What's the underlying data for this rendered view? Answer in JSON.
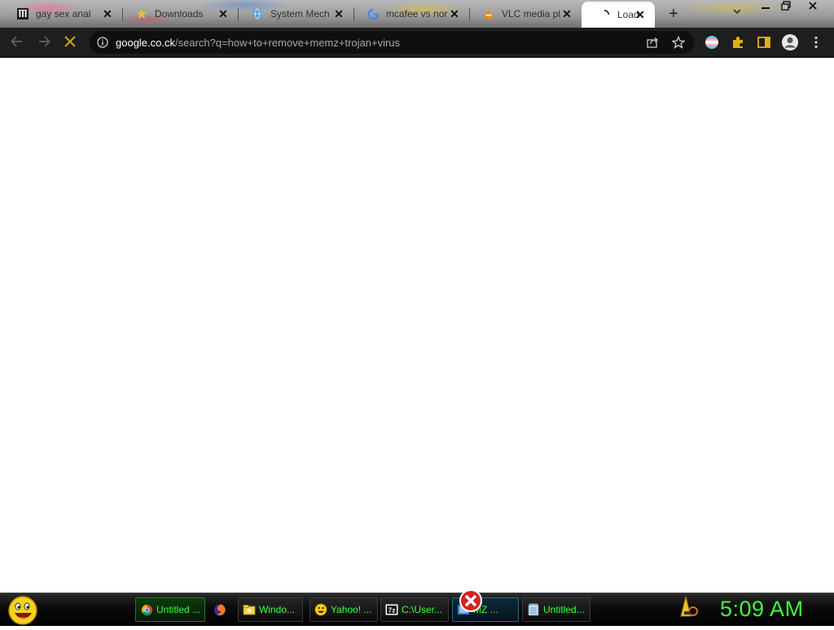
{
  "browser": {
    "tabs": [
      {
        "title": "gay sex anal",
        "icon": "library-icon"
      },
      {
        "title": "Downloads",
        "icon": "star-icon"
      },
      {
        "title": "System Mech",
        "icon": "globe-icon"
      },
      {
        "title": "mcafee vs nor",
        "icon": "google-icon"
      },
      {
        "title": "VLC media pl",
        "icon": "vlc-icon"
      },
      {
        "title": "Load",
        "icon": "loading-icon",
        "active": true
      }
    ],
    "new_tab": "+",
    "address": {
      "host": "google.co.ck",
      "path": "/search?q=how+to+remove+memz+trojan+virus"
    },
    "colors": {
      "toolbar": "#1e1e1e",
      "omnibox": "#0f0f0f",
      "accent_extensions": "#e0b010"
    }
  },
  "taskbar": {
    "buttons": [
      {
        "label": "Untitled ...",
        "icon": "chrome-icon"
      },
      {
        "label": "",
        "icon": "firefox-icon"
      },
      {
        "label": "Windo...",
        "icon": "folder-icon"
      },
      {
        "label": "Yahoo! ...",
        "icon": "yahoo-messenger-icon"
      },
      {
        "label": "C:\\User...",
        "icon": "7zip-icon"
      },
      {
        "label": "MZ ...",
        "icon": "memz-icon"
      },
      {
        "label": "Untitled...",
        "icon": "notepad-icon"
      }
    ],
    "clock": "5:09 AM",
    "colors": {
      "text": "#3dff3d"
    }
  }
}
